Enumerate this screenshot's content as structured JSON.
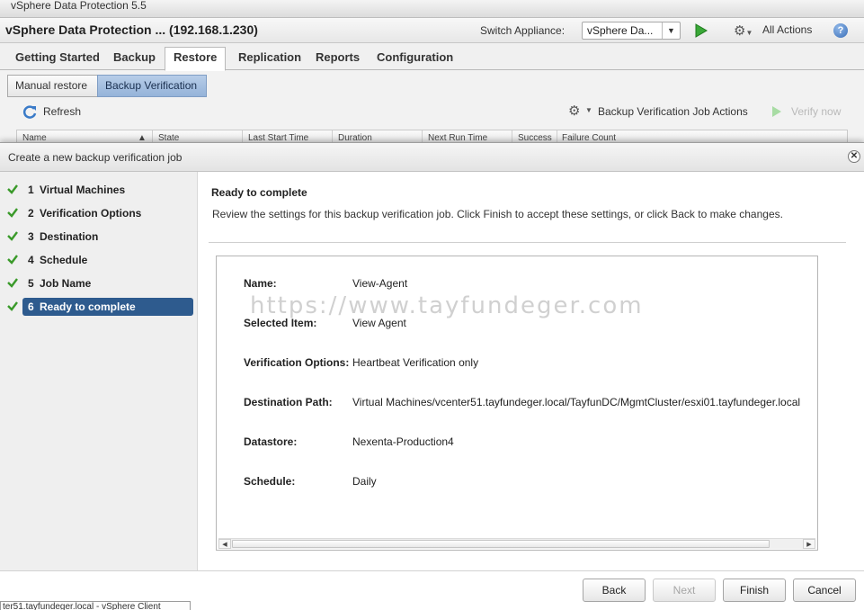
{
  "app": {
    "title": "vSphere Data Protection 5.5",
    "header_title": "vSphere Data Protection ... (192.168.1.230)",
    "switch_label": "Switch Appliance:",
    "switch_value": "vSphere Da...",
    "all_actions": "All Actions",
    "help": "?"
  },
  "tabs": [
    "Getting Started",
    "Backup",
    "Restore",
    "Replication",
    "Reports",
    "Configuration"
  ],
  "active_tab": "Restore",
  "subtabs": [
    "Manual restore",
    "Backup Verification"
  ],
  "toolbar": {
    "refresh": "Refresh",
    "job_actions": "Backup Verification Job Actions",
    "verify_now": "Verify now"
  },
  "grid_headers": [
    "Name",
    "State",
    "Last Start Time",
    "Duration",
    "Next Run Time",
    "Success",
    "Failure Count"
  ],
  "modal": {
    "title": "Create a new backup verification job",
    "steps": [
      {
        "num": "1",
        "label": "Virtual Machines"
      },
      {
        "num": "2",
        "label": "Verification Options"
      },
      {
        "num": "3",
        "label": "Destination"
      },
      {
        "num": "4",
        "label": "Schedule"
      },
      {
        "num": "5",
        "label": "Job Name"
      },
      {
        "num": "6",
        "label": "Ready to complete"
      }
    ],
    "active_step": 6,
    "heading": "Ready to complete",
    "description": "Review the settings for this backup verification job.  Click Finish to accept these settings, or click Back to make changes.",
    "summary": [
      {
        "key": "Name:",
        "value": "View-Agent"
      },
      {
        "key": "Selected Item:",
        "value": "View Agent"
      },
      {
        "key": "Verification Options:",
        "value": "Heartbeat Verification only"
      },
      {
        "key": "Destination Path:",
        "value": "Virtual Machines/vcenter51.tayfundeger.local/TayfunDC/MgmtCluster/esxi01.tayfundeger.local"
      },
      {
        "key": "Datastore:",
        "value": "Nexenta-Production4"
      },
      {
        "key": "Schedule:",
        "value": "Daily"
      }
    ],
    "watermark": "https://www.tayfundeger.com",
    "buttons": {
      "back": "Back",
      "next": "Next",
      "finish": "Finish",
      "cancel": "Cancel"
    }
  },
  "taskbar": "ter51.tayfundeger.local - vSphere Client",
  "colors": {
    "active_step_bg": "#2e5b8e",
    "check_green": "#3a9a2a",
    "subtab_active": "#95b3d9"
  }
}
